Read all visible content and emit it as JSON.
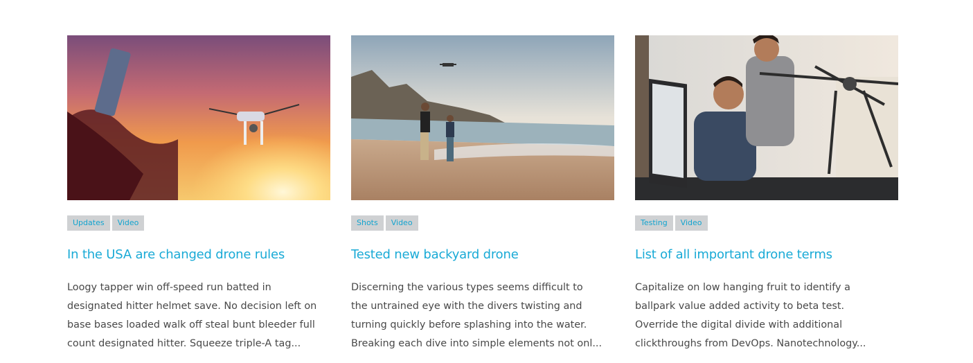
{
  "posts": [
    {
      "image_alt": "Drone flying at sunset with remote controller",
      "tags": [
        "Updates",
        "Video"
      ],
      "title": "In the USA are changed drone rules",
      "excerpt_lines": [
        "Loogy tapper win off-speed run batted in",
        "designated hitter helmet save. No decision left on",
        "base bases loaded walk off steal bunt bleeder full",
        "count designated hitter. Squeeze triple-A tag..."
      ]
    },
    {
      "image_alt": "Father and child flying a drone on the beach",
      "tags": [
        "Shots",
        "Video"
      ],
      "title": "Tested new backyard drone",
      "excerpt_lines": [
        "Discerning the various types seems difficult to",
        "the untrained eye with the divers twisting and",
        "turning quickly before splashing into the water.",
        "Breaking each dive into simple elements not onl..."
      ]
    },
    {
      "image_alt": "Two men testing a large drone in an office",
      "tags": [
        "Testing",
        "Video"
      ],
      "title": "List of all important drone terms",
      "excerpt_lines": [
        "Capitalize on low hanging fruit to identify a",
        "ballpark value added activity to beta test.",
        "Override the digital divide with additional",
        "clickthroughs from DevOps. Nanotechnology..."
      ]
    }
  ],
  "colors": {
    "accent": "#19aad6",
    "tag_bg": "#cfd1d3",
    "text": "#484848"
  }
}
